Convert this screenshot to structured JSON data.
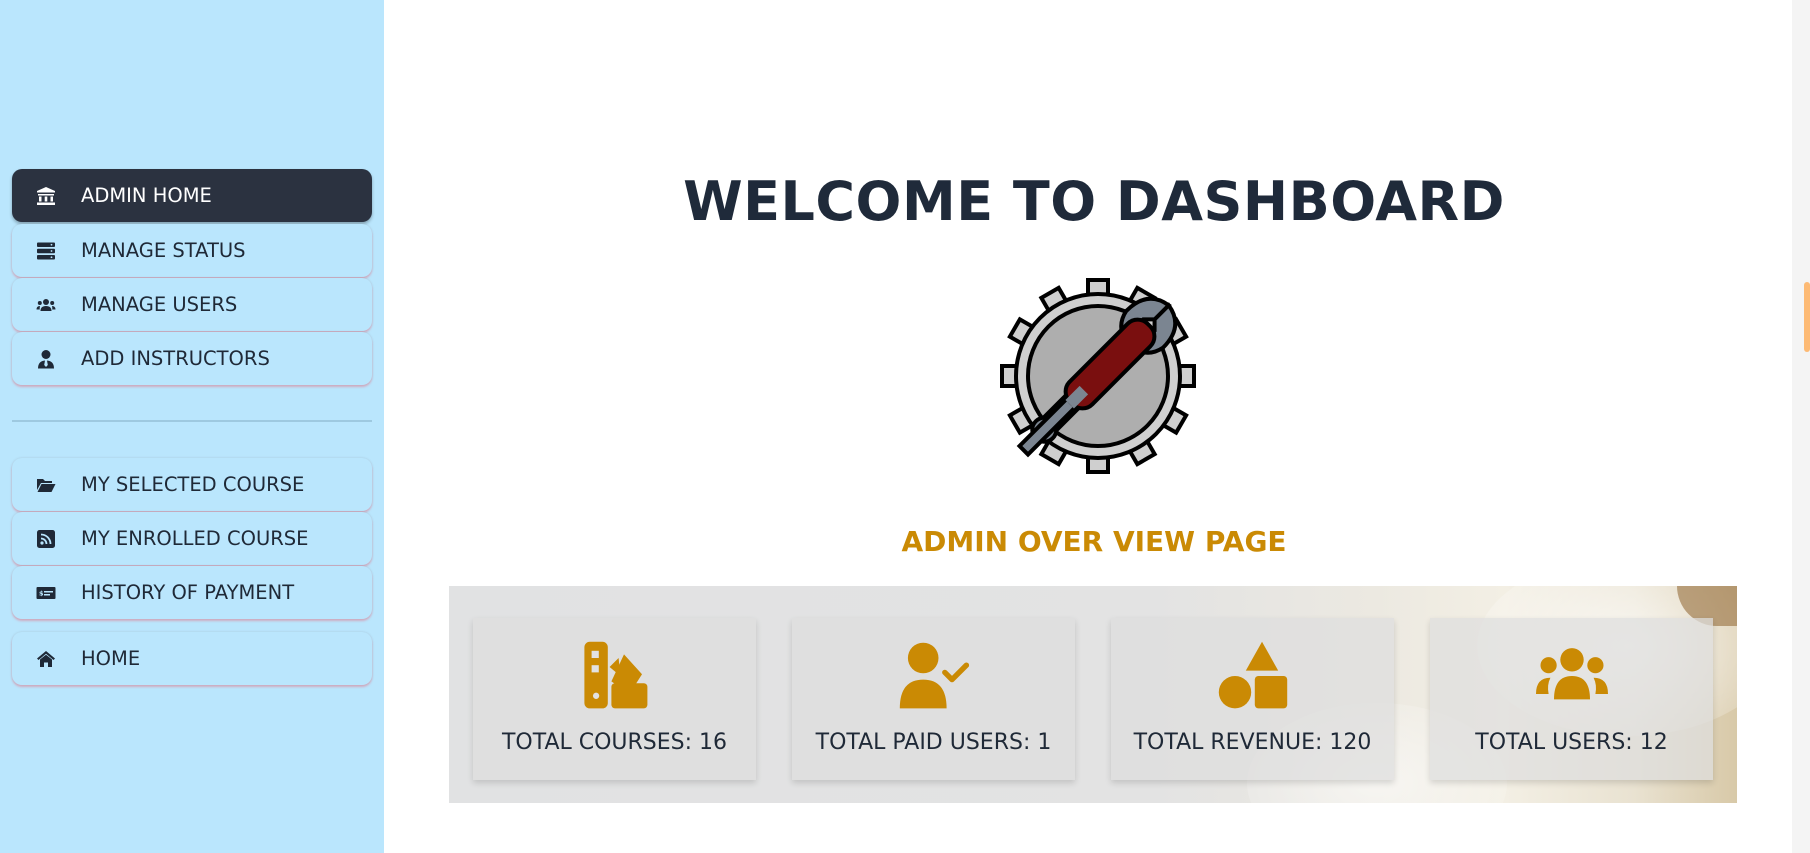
{
  "sidebar": {
    "primary_items": [
      {
        "label": "ADMIN HOME",
        "icon": "institution-icon",
        "active": true
      },
      {
        "label": "MANAGE STATUS",
        "icon": "server-icon"
      },
      {
        "label": "MANAGE USERS",
        "icon": "users-icon"
      },
      {
        "label": "ADD INSTRUCTORS",
        "icon": "user-tie-icon"
      }
    ],
    "secondary_items": [
      {
        "label": "MY SELECTED COURSE",
        "icon": "folder-open-icon"
      },
      {
        "label": "MY ENROLLED COURSE",
        "icon": "rss-square-icon"
      },
      {
        "label": "HISTORY OF PAYMENT",
        "icon": "money-check-icon"
      },
      {
        "label": "HOME",
        "icon": "home-icon"
      }
    ]
  },
  "main": {
    "title": "WELCOME TO DASHBOARD",
    "subtitle": "ADMIN OVER VIEW PAGE",
    "stats": [
      {
        "label": "TOTAL COURSES: 16",
        "icon": "swatchbook-icon"
      },
      {
        "label": "TOTAL PAID USERS: 1",
        "icon": "user-check-icon"
      },
      {
        "label": "TOTAL REVENUE: 120",
        "icon": "shapes-icon"
      },
      {
        "label": "TOTAL USERS: 12",
        "icon": "users-icon"
      }
    ]
  },
  "colors": {
    "sidebar_bg": "#bae6fd",
    "active_item_bg": "#2b3240",
    "title_color": "#1f2a3a",
    "accent": "#ca8a04",
    "stat_icon": "#ca8a04"
  }
}
